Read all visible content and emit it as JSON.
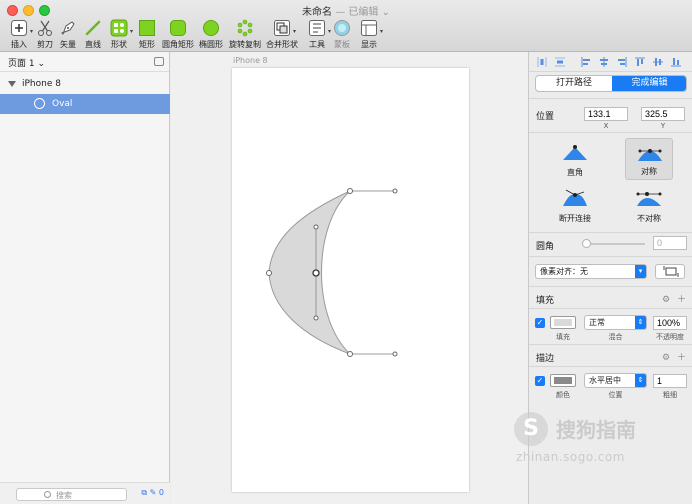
{
  "window": {
    "title": "未命名",
    "subtitle": "— 已编辑 ⌄"
  },
  "toolbar": {
    "items": [
      {
        "label": "插入",
        "icon": "plus-icon"
      },
      {
        "label": "剪刀",
        "icon": "scissors-icon"
      },
      {
        "label": "矢量",
        "icon": "pen-icon"
      },
      {
        "label": "直线",
        "icon": "line-icon"
      },
      {
        "label": "形状",
        "icon": "shapes-icon"
      },
      {
        "label": "矩形",
        "icon": "rectangle-icon"
      },
      {
        "label": "圆角矩形",
        "icon": "rounded-rectangle-icon"
      },
      {
        "label": "椭圆形",
        "icon": "oval-icon"
      },
      {
        "label": "旋转复制",
        "icon": "rotate-copy-icon"
      },
      {
        "label": "合并形状",
        "icon": "combine-shapes-icon"
      },
      {
        "label": "工具",
        "icon": "tools-icon"
      },
      {
        "label": "蒙板",
        "icon": "mask-icon"
      },
      {
        "label": "显示",
        "icon": "view-icon"
      }
    ],
    "accent_green": "#7ed321"
  },
  "sidebar": {
    "page_selector": "页面 1 ⌄",
    "layers": [
      {
        "name": "iPhone 8",
        "type": "artboard"
      },
      {
        "name": "Oval",
        "type": "oval",
        "selected": true
      }
    ],
    "search_placeholder": "搜索",
    "footer_count": "0"
  },
  "canvas": {
    "artboard_name": "iPhone 8",
    "shape_fill": "#d9d9d9",
    "shape_stroke": "#9a9a9a"
  },
  "inspector": {
    "open_path_label": "打开路径",
    "finish_edit_label": "完成编辑",
    "position_label": "位置",
    "x_value": "133.1",
    "y_value": "325.5",
    "x_label": "X",
    "y_label": "Y",
    "point_types": [
      {
        "label": "直角",
        "icon": "straight-point-icon",
        "selected": false
      },
      {
        "label": "对称",
        "icon": "mirrored-point-icon",
        "selected": true
      },
      {
        "label": "断开连接",
        "icon": "disconnected-point-icon",
        "selected": false
      },
      {
        "label": "不对称",
        "icon": "asymmetric-point-icon",
        "selected": false
      }
    ],
    "corner_label": "圆角",
    "corner_value": "0",
    "pixel_align_label": "像素对齐：无",
    "fill_section": "填充",
    "fill": {
      "blend_mode": "正常",
      "opacity": "100%",
      "swatch_label": "填充",
      "blend_label": "混合",
      "opacity_label": "不透明度",
      "color": "#d9d9d9"
    },
    "border_section": "描边",
    "border": {
      "position": "水平居中",
      "thickness": "1",
      "swatch_label": "颜色",
      "position_label": "位置",
      "thickness_label": "粗细",
      "color": "#8a8a8a"
    },
    "accent_blue": "#1a7cf5"
  },
  "watermark": {
    "logo_glyph": "S",
    "text": "搜狗指南",
    "url": "zhinan.sogo.com"
  }
}
